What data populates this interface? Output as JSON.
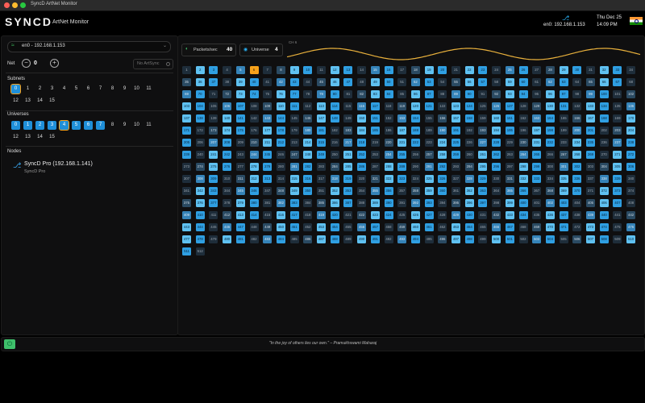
{
  "window": {
    "title": "SyncD ArtNet Monitor"
  },
  "header": {
    "logo": "SYNCD",
    "app_title": "ArtNet Monitor",
    "interface": "en0: 192.168.1.153",
    "date": "Thu Dec 25",
    "time": "14:09 PM"
  },
  "sidebar": {
    "interface_dropdown": "en0 - 192.168.1.153",
    "net": {
      "label": "Net",
      "value": "0"
    },
    "artsync_label": "No ArtSync",
    "subnets_label": "Subnets",
    "universes_label": "Universes",
    "nodes_label": "Nodes",
    "subnets": [
      {
        "label": "0",
        "state": "sel"
      },
      {
        "label": "1",
        "state": "off"
      },
      {
        "label": "2",
        "state": "off"
      },
      {
        "label": "3",
        "state": "off"
      },
      {
        "label": "4",
        "state": "off"
      },
      {
        "label": "5",
        "state": "off"
      },
      {
        "label": "6",
        "state": "off"
      },
      {
        "label": "7",
        "state": "off"
      },
      {
        "label": "8",
        "state": "off"
      },
      {
        "label": "9",
        "state": "off"
      },
      {
        "label": "10",
        "state": "off"
      },
      {
        "label": "11",
        "state": "off"
      },
      {
        "label": "12",
        "state": "off"
      },
      {
        "label": "13",
        "state": "off"
      },
      {
        "label": "14",
        "state": "off"
      },
      {
        "label": "15",
        "state": "off"
      }
    ],
    "universes": [
      {
        "label": "0",
        "state": "on"
      },
      {
        "label": "1",
        "state": "on"
      },
      {
        "label": "2",
        "state": "on"
      },
      {
        "label": "3",
        "state": "on"
      },
      {
        "label": "4",
        "state": "sel"
      },
      {
        "label": "5",
        "state": "on"
      },
      {
        "label": "6",
        "state": "on"
      },
      {
        "label": "7",
        "state": "on"
      },
      {
        "label": "8",
        "state": "off"
      },
      {
        "label": "9",
        "state": "off"
      },
      {
        "label": "10",
        "state": "off"
      },
      {
        "label": "11",
        "state": "off"
      },
      {
        "label": "12",
        "state": "off"
      },
      {
        "label": "13",
        "state": "off"
      },
      {
        "label": "14",
        "state": "off"
      },
      {
        "label": "15",
        "state": "off"
      }
    ],
    "nodes": [
      {
        "name": "SyncD Pro (192.168.1.141)",
        "sub": "SyncD Pro"
      }
    ]
  },
  "stats": {
    "packets_label": "Packets/sec",
    "packets_value": "40",
    "universe_label": "Universe",
    "universe_value": "4",
    "channel_label": "CH 6"
  },
  "channels": {
    "count": 512,
    "highlighted": 6
  },
  "footer": {
    "quote": "\"In the joy of others lies our own.\" – Pramukhswami Maharaj"
  },
  "colors": {
    "accent": "#1f8fd8",
    "highlight": "#f7a21b",
    "status_ok": "#3fc06b"
  }
}
